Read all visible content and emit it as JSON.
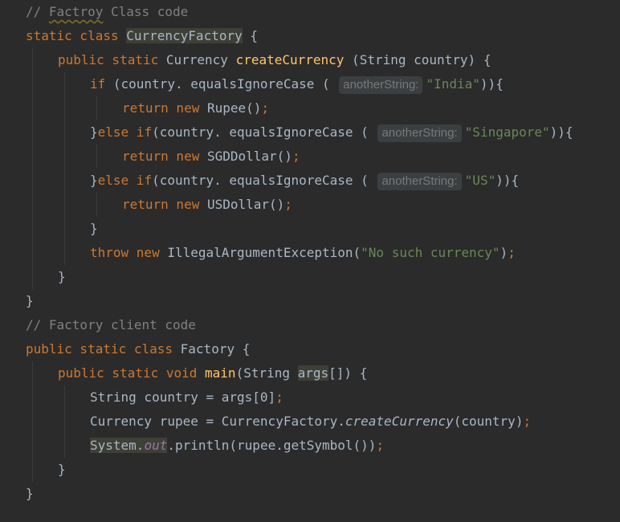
{
  "lines": {
    "l1": {
      "comment_a": "// ",
      "comment_word": "Factroy",
      "comment_b": " Class code"
    },
    "l2": {
      "kw": "static class ",
      "name": "CurrencyFactory",
      "rest": " {"
    },
    "l3": {
      "kw": "public static ",
      "type": "Currency ",
      "method": "createCurrency",
      "rest": " (String country) {"
    },
    "l4": {
      "kw": "if",
      "pre": " (country. equalsIgnoreCase ( ",
      "hint": "anotherString:",
      "str": "\"India\"",
      "post": ")){"
    },
    "l5": {
      "kw": "return new ",
      "rest": "Rupee()",
      "semi": ";"
    },
    "l6": {
      "pre": "}",
      "kw": "else if",
      "mid": "(country. equalsIgnoreCase ( ",
      "hint": "anotherString:",
      "str": "\"Singapore\"",
      "post": ")){"
    },
    "l7": {
      "kw": "return new ",
      "rest": "SGDDollar()",
      "semi": ";"
    },
    "l8": {
      "pre": "}",
      "kw": "else if",
      "mid": "(country. equalsIgnoreCase ( ",
      "hint": "anotherString:",
      "str": "\"US\"",
      "post": ")){"
    },
    "l9": {
      "kw": "return new ",
      "rest": "USDollar()",
      "semi": ";"
    },
    "l10": {
      "text": "}"
    },
    "l11": {
      "kw": "throw new ",
      "rest": "IllegalArgumentException(",
      "str": "\"No such currency\"",
      "post": ")",
      "semi": ";"
    },
    "l12": {
      "text": "}"
    },
    "l13": {
      "text": "}"
    },
    "l14": {
      "comment": "// Factory client code"
    },
    "l15": {
      "kw": "public static class ",
      "rest": "Factory {"
    },
    "l16": {
      "kw": "public static void ",
      "method": "main",
      "pre": "(String ",
      "arg": "args",
      "post": "[]) {"
    },
    "l17": {
      "text": "String country = args[0]",
      "semi": ";"
    },
    "l18": {
      "pre": "Currency rupee = CurrencyFactory.",
      "call": "createCurrency",
      "post": "(country)",
      "semi": ";"
    },
    "l19": {
      "sys": "System.",
      "field": "out",
      "post": ".println(rupee.getSymbol())",
      "semi": ";"
    },
    "l20": {
      "text": "}"
    },
    "l21": {
      "text": "}"
    }
  }
}
